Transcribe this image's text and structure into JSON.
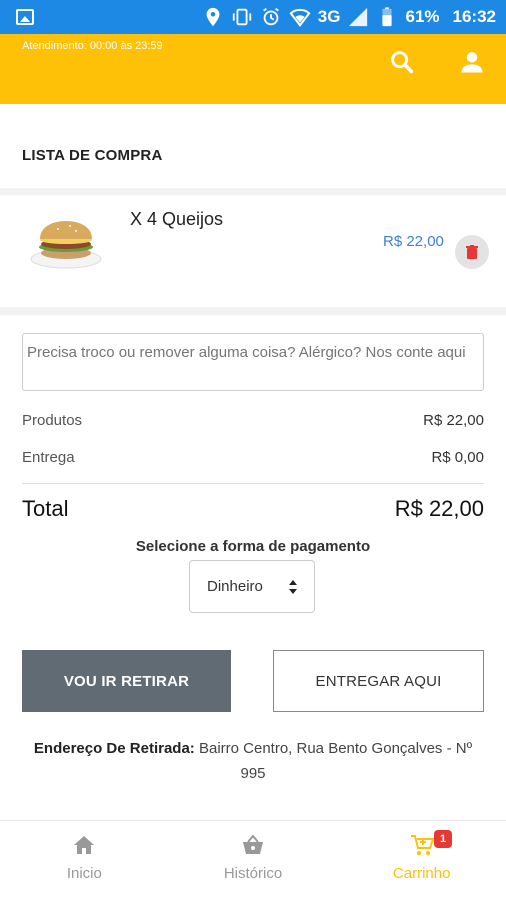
{
  "status_bar": {
    "battery": "61%",
    "time": "16:32",
    "network": "3G",
    "icons": [
      "image-icon",
      "location-icon",
      "vibrate-icon",
      "alarm-icon",
      "wifi-icon",
      "signal-icon",
      "battery-icon"
    ]
  },
  "header": {
    "hours": "Atendimento: 00:00 às 23:59",
    "icons": [
      "search-icon",
      "account-icon"
    ],
    "color": "#ffc107"
  },
  "cart": {
    "title": "LISTA DE COMPRA",
    "items": [
      {
        "name": "X 4 Queijos",
        "price": "R$ 22,00"
      }
    ]
  },
  "order": {
    "note_placeholder": "Precisa troco ou remover alguma coisa? Alérgico? Nos conte aqui",
    "products_label": "Produtos",
    "products_value": "R$ 22,00",
    "delivery_label": "Entrega",
    "delivery_value": "R$ 0,00",
    "total_label": "Total",
    "total_value": "R$ 22,00",
    "payment_label": "Selecione a forma de pagamento",
    "payment_selected": "Dinheiro",
    "pickup_button": "VOU IR RETIRAR",
    "deliver_button": "ENTREGAR AQUI",
    "address_label": "Endereço De Retirada:",
    "address_value": "Bairro Centro, Rua Bento Gonçalves - Nº 995"
  },
  "bottom_nav": {
    "items": [
      {
        "label": "Inicio",
        "icon": "home-icon"
      },
      {
        "label": "Histórico",
        "icon": "basket-icon"
      },
      {
        "label": "Carrinho",
        "icon": "cart-icon",
        "active": true
      }
    ],
    "cart_badge": "1",
    "active_color": "#ffc107"
  }
}
